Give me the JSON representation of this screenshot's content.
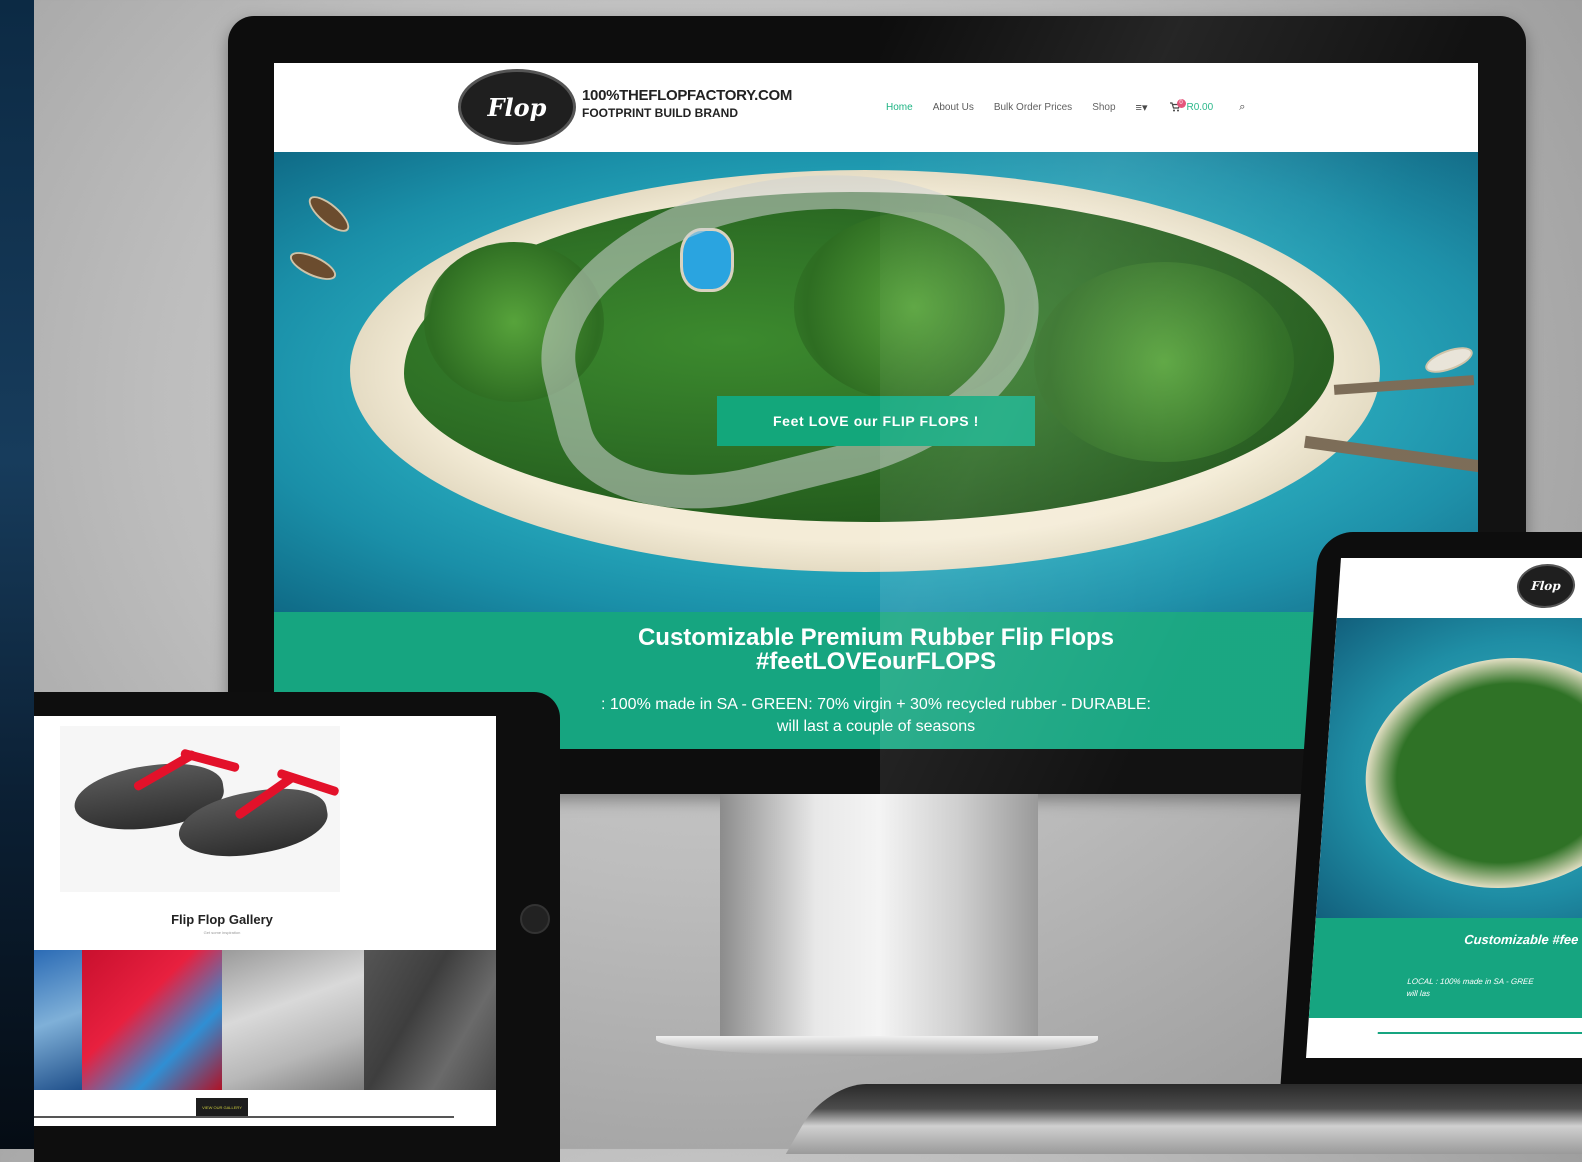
{
  "site": {
    "logo": {
      "badge_text": "Flop",
      "line1": "100%THEFLOPFACTORY.COM",
      "line2": "FOOTPRINT BUILD BRAND"
    },
    "nav": {
      "home": "Home",
      "about": "About Us",
      "bulk": "Bulk Order Prices",
      "shop": "Shop",
      "menu_icon": "≡▾",
      "cart_count": "0",
      "cart_total": "R0.00",
      "search_icon": "⌕"
    },
    "hero": {
      "cta": "Feet LOVE our FLIP FLOPS !"
    },
    "tagline": {
      "title_line1": "Customizable Premium Rubber Flip Flops",
      "title_line2": "#feetLOVEourFLOPS",
      "sub_line1": ": 100% made in SA - GREEN: 70% virgin + 30% recycled rubber - DURABLE:",
      "sub_line2": "will last a couple of seasons"
    }
  },
  "tablet": {
    "gallery_title": "Flip Flop Gallery",
    "gallery_subtitle": "Get some inspiration",
    "gallery_button": "VIEW OUR GALLERY"
  },
  "laptop": {
    "badge_text": "Flop",
    "title": "Customizable #fee",
    "sub_line1": "LOCAL : 100% made in SA - GREE",
    "sub_line2": "will las"
  },
  "colors": {
    "brand_green": "#16a580",
    "cta_green": "#13a77b",
    "nav_active": "#19b281",
    "cart_badge": "#e2456f",
    "strap_red": "#e3112a"
  }
}
